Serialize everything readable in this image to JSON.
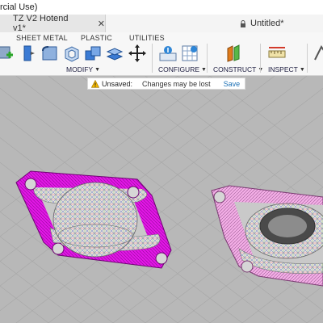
{
  "window": {
    "title": "rcial Use)"
  },
  "tabs": [
    {
      "label": "TZ V2 Hotend v1*",
      "close": "✕"
    },
    {
      "label": "Untitled*"
    }
  ],
  "toolbar": {
    "workspaces": [
      "SHEET METAL",
      "PLASTIC",
      "UTILITIES"
    ],
    "groups": {
      "modify": "MODIFY",
      "configure": "CONFIGURE",
      "construct": "CONSTRUCT",
      "inspect": "INSPECT"
    }
  },
  "banner": {
    "unsaved": "Unsaved:",
    "message": "Changes may be lost",
    "save": "Save"
  },
  "colors": {
    "accent": "#1a6fb5",
    "magenta_part": "#e216e6",
    "pink_part": "#f3aee6",
    "viewport": "#b8b8b8"
  }
}
